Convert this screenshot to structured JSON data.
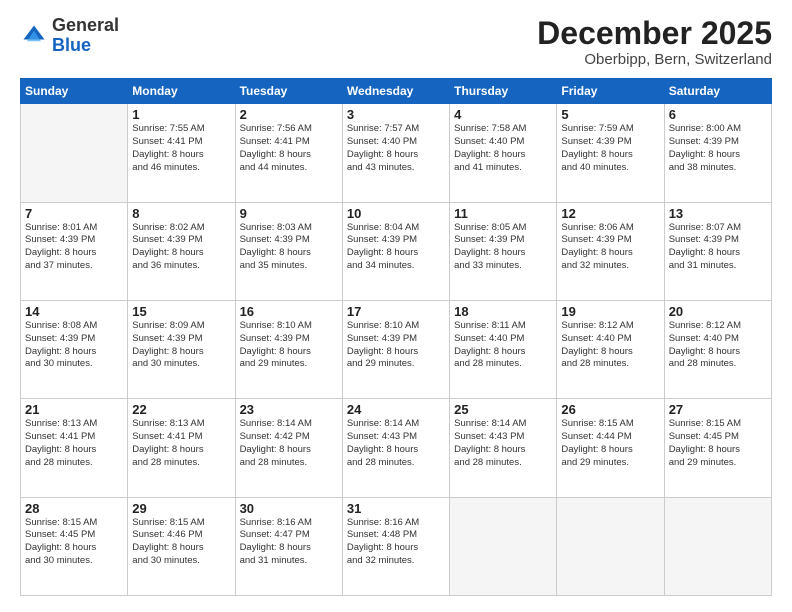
{
  "header": {
    "logo_line1": "General",
    "logo_line2": "Blue",
    "month": "December 2025",
    "location": "Oberbipp, Bern, Switzerland"
  },
  "days_of_week": [
    "Sunday",
    "Monday",
    "Tuesday",
    "Wednesday",
    "Thursday",
    "Friday",
    "Saturday"
  ],
  "weeks": [
    [
      {
        "day": "",
        "info": ""
      },
      {
        "day": "1",
        "info": "Sunrise: 7:55 AM\nSunset: 4:41 PM\nDaylight: 8 hours\nand 46 minutes."
      },
      {
        "day": "2",
        "info": "Sunrise: 7:56 AM\nSunset: 4:41 PM\nDaylight: 8 hours\nand 44 minutes."
      },
      {
        "day": "3",
        "info": "Sunrise: 7:57 AM\nSunset: 4:40 PM\nDaylight: 8 hours\nand 43 minutes."
      },
      {
        "day": "4",
        "info": "Sunrise: 7:58 AM\nSunset: 4:40 PM\nDaylight: 8 hours\nand 41 minutes."
      },
      {
        "day": "5",
        "info": "Sunrise: 7:59 AM\nSunset: 4:39 PM\nDaylight: 8 hours\nand 40 minutes."
      },
      {
        "day": "6",
        "info": "Sunrise: 8:00 AM\nSunset: 4:39 PM\nDaylight: 8 hours\nand 38 minutes."
      }
    ],
    [
      {
        "day": "7",
        "info": "Sunrise: 8:01 AM\nSunset: 4:39 PM\nDaylight: 8 hours\nand 37 minutes."
      },
      {
        "day": "8",
        "info": "Sunrise: 8:02 AM\nSunset: 4:39 PM\nDaylight: 8 hours\nand 36 minutes."
      },
      {
        "day": "9",
        "info": "Sunrise: 8:03 AM\nSunset: 4:39 PM\nDaylight: 8 hours\nand 35 minutes."
      },
      {
        "day": "10",
        "info": "Sunrise: 8:04 AM\nSunset: 4:39 PM\nDaylight: 8 hours\nand 34 minutes."
      },
      {
        "day": "11",
        "info": "Sunrise: 8:05 AM\nSunset: 4:39 PM\nDaylight: 8 hours\nand 33 minutes."
      },
      {
        "day": "12",
        "info": "Sunrise: 8:06 AM\nSunset: 4:39 PM\nDaylight: 8 hours\nand 32 minutes."
      },
      {
        "day": "13",
        "info": "Sunrise: 8:07 AM\nSunset: 4:39 PM\nDaylight: 8 hours\nand 31 minutes."
      }
    ],
    [
      {
        "day": "14",
        "info": "Sunrise: 8:08 AM\nSunset: 4:39 PM\nDaylight: 8 hours\nand 30 minutes."
      },
      {
        "day": "15",
        "info": "Sunrise: 8:09 AM\nSunset: 4:39 PM\nDaylight: 8 hours\nand 30 minutes."
      },
      {
        "day": "16",
        "info": "Sunrise: 8:10 AM\nSunset: 4:39 PM\nDaylight: 8 hours\nand 29 minutes."
      },
      {
        "day": "17",
        "info": "Sunrise: 8:10 AM\nSunset: 4:39 PM\nDaylight: 8 hours\nand 29 minutes."
      },
      {
        "day": "18",
        "info": "Sunrise: 8:11 AM\nSunset: 4:40 PM\nDaylight: 8 hours\nand 28 minutes."
      },
      {
        "day": "19",
        "info": "Sunrise: 8:12 AM\nSunset: 4:40 PM\nDaylight: 8 hours\nand 28 minutes."
      },
      {
        "day": "20",
        "info": "Sunrise: 8:12 AM\nSunset: 4:40 PM\nDaylight: 8 hours\nand 28 minutes."
      }
    ],
    [
      {
        "day": "21",
        "info": "Sunrise: 8:13 AM\nSunset: 4:41 PM\nDaylight: 8 hours\nand 28 minutes."
      },
      {
        "day": "22",
        "info": "Sunrise: 8:13 AM\nSunset: 4:41 PM\nDaylight: 8 hours\nand 28 minutes."
      },
      {
        "day": "23",
        "info": "Sunrise: 8:14 AM\nSunset: 4:42 PM\nDaylight: 8 hours\nand 28 minutes."
      },
      {
        "day": "24",
        "info": "Sunrise: 8:14 AM\nSunset: 4:43 PM\nDaylight: 8 hours\nand 28 minutes."
      },
      {
        "day": "25",
        "info": "Sunrise: 8:14 AM\nSunset: 4:43 PM\nDaylight: 8 hours\nand 28 minutes."
      },
      {
        "day": "26",
        "info": "Sunrise: 8:15 AM\nSunset: 4:44 PM\nDaylight: 8 hours\nand 29 minutes."
      },
      {
        "day": "27",
        "info": "Sunrise: 8:15 AM\nSunset: 4:45 PM\nDaylight: 8 hours\nand 29 minutes."
      }
    ],
    [
      {
        "day": "28",
        "info": "Sunrise: 8:15 AM\nSunset: 4:45 PM\nDaylight: 8 hours\nand 30 minutes."
      },
      {
        "day": "29",
        "info": "Sunrise: 8:15 AM\nSunset: 4:46 PM\nDaylight: 8 hours\nand 30 minutes."
      },
      {
        "day": "30",
        "info": "Sunrise: 8:16 AM\nSunset: 4:47 PM\nDaylight: 8 hours\nand 31 minutes."
      },
      {
        "day": "31",
        "info": "Sunrise: 8:16 AM\nSunset: 4:48 PM\nDaylight: 8 hours\nand 32 minutes."
      },
      {
        "day": "",
        "info": ""
      },
      {
        "day": "",
        "info": ""
      },
      {
        "day": "",
        "info": ""
      }
    ]
  ]
}
